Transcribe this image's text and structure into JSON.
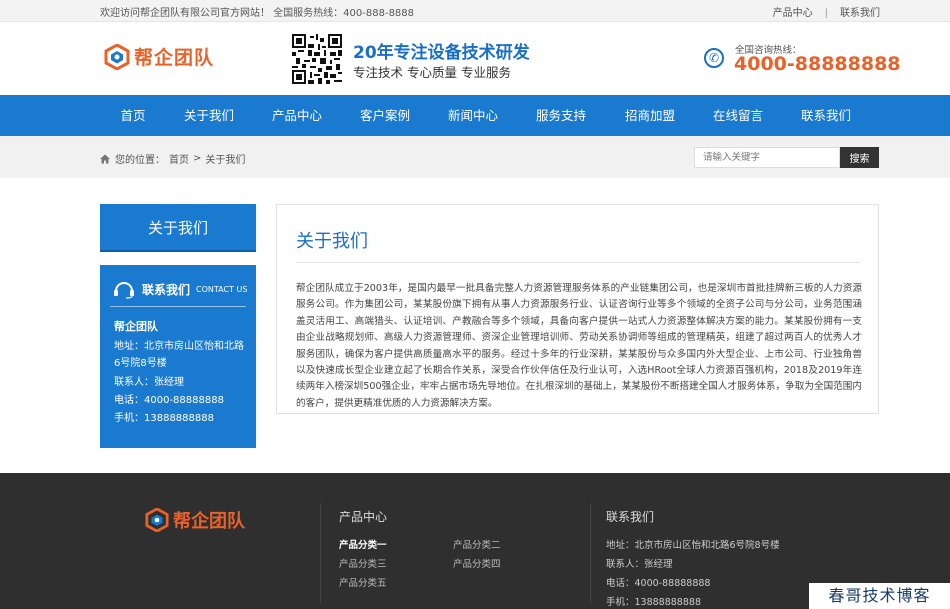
{
  "topbar": {
    "welcome": "欢迎访问帮企团队有限公司官方网站！ 全国服务热线：400-888-8888",
    "links": [
      "产品中心",
      "联系我们"
    ]
  },
  "header": {
    "logo_text": "帮企团队",
    "slogan_main": "20年专注设备技术研发",
    "slogan_sub": "专注技术 专心质量 专业服务",
    "hotline_label": "全国咨询热线：",
    "hotline_number": "4000-88888888"
  },
  "nav": {
    "items": [
      "首页",
      "关于我们",
      "产品中心",
      "客户案例",
      "新闻中心",
      "服务支持",
      "招商加盟",
      "在线留言",
      "联系我们"
    ]
  },
  "breadcrumb": {
    "label": "您的位置：",
    "home": "首页",
    "separator": ">",
    "current": "关于我们"
  },
  "search": {
    "placeholder": "请输入关键字",
    "button": "搜索"
  },
  "sidebar": {
    "title": "关于我们",
    "contact_cn": "联系我们",
    "contact_en": "CONTACT US",
    "company": "帮企团队",
    "rows": [
      "地址：北京市房山区怡和北路6号院8号楼",
      "联系人：张经理",
      "电话：4000-88888888",
      "手机：13888888888"
    ]
  },
  "content": {
    "title": "关于我们",
    "body": "帮企团队成立于2003年，是国内最早一批具备完整人力资源管理服务体系的产业链集团公司，也是深圳市首批挂牌新三板的人力资源服务公司。作为集团公司，某某股份旗下拥有从事人力资源服务行业、认证咨询行业等多个领域的全资子公司与分公司，业务范围涵盖灵活用工、高端猎头、认证培训、产教融合等多个领域，具备向客户提供一站式人力资源整体解决方案的能力。某某股份拥有一支由企业战略规划师、高级人力资源管理师、资深企业管理培训师、劳动关系协调师等组成的管理精英，组建了超过两百人的优秀人才服务团队，确保为客户提供高质量高水平的服务。经过十多年的行业深耕，某某股份与众多国内外大型企业、上市公司、行业独角兽以及快速成长型企业建立起了长期合作关系，深受合作伙伴信任及行业认可，入选HRoot全球人力资源百强机构，2018及2019年连续两年入榜深圳500强企业，牢牢占据市场先导地位。在扎根深圳的基础上，某某股份不断搭建全国人才服务体系，争取为全国范围内的客户，提供更精准优质的人力资源解决方案。"
  },
  "footer": {
    "logo_text": "帮企团队",
    "products_title": "产品中心",
    "products": [
      "产品分类一",
      "产品分类二",
      "产品分类三",
      "产品分类四",
      "产品分类五"
    ],
    "contact_title": "联系我们",
    "contact_rows": [
      "地址：北京市房山区怡和北路6号院8号楼",
      "联系人：张经理",
      "电话：4000-88888888",
      "手机：13888888888"
    ]
  },
  "watermark": "春哥技术博客",
  "colors": {
    "brand_blue": "#1a7ad0",
    "accent_orange": "#e8622a",
    "footer_bg": "#2f2f2f"
  }
}
